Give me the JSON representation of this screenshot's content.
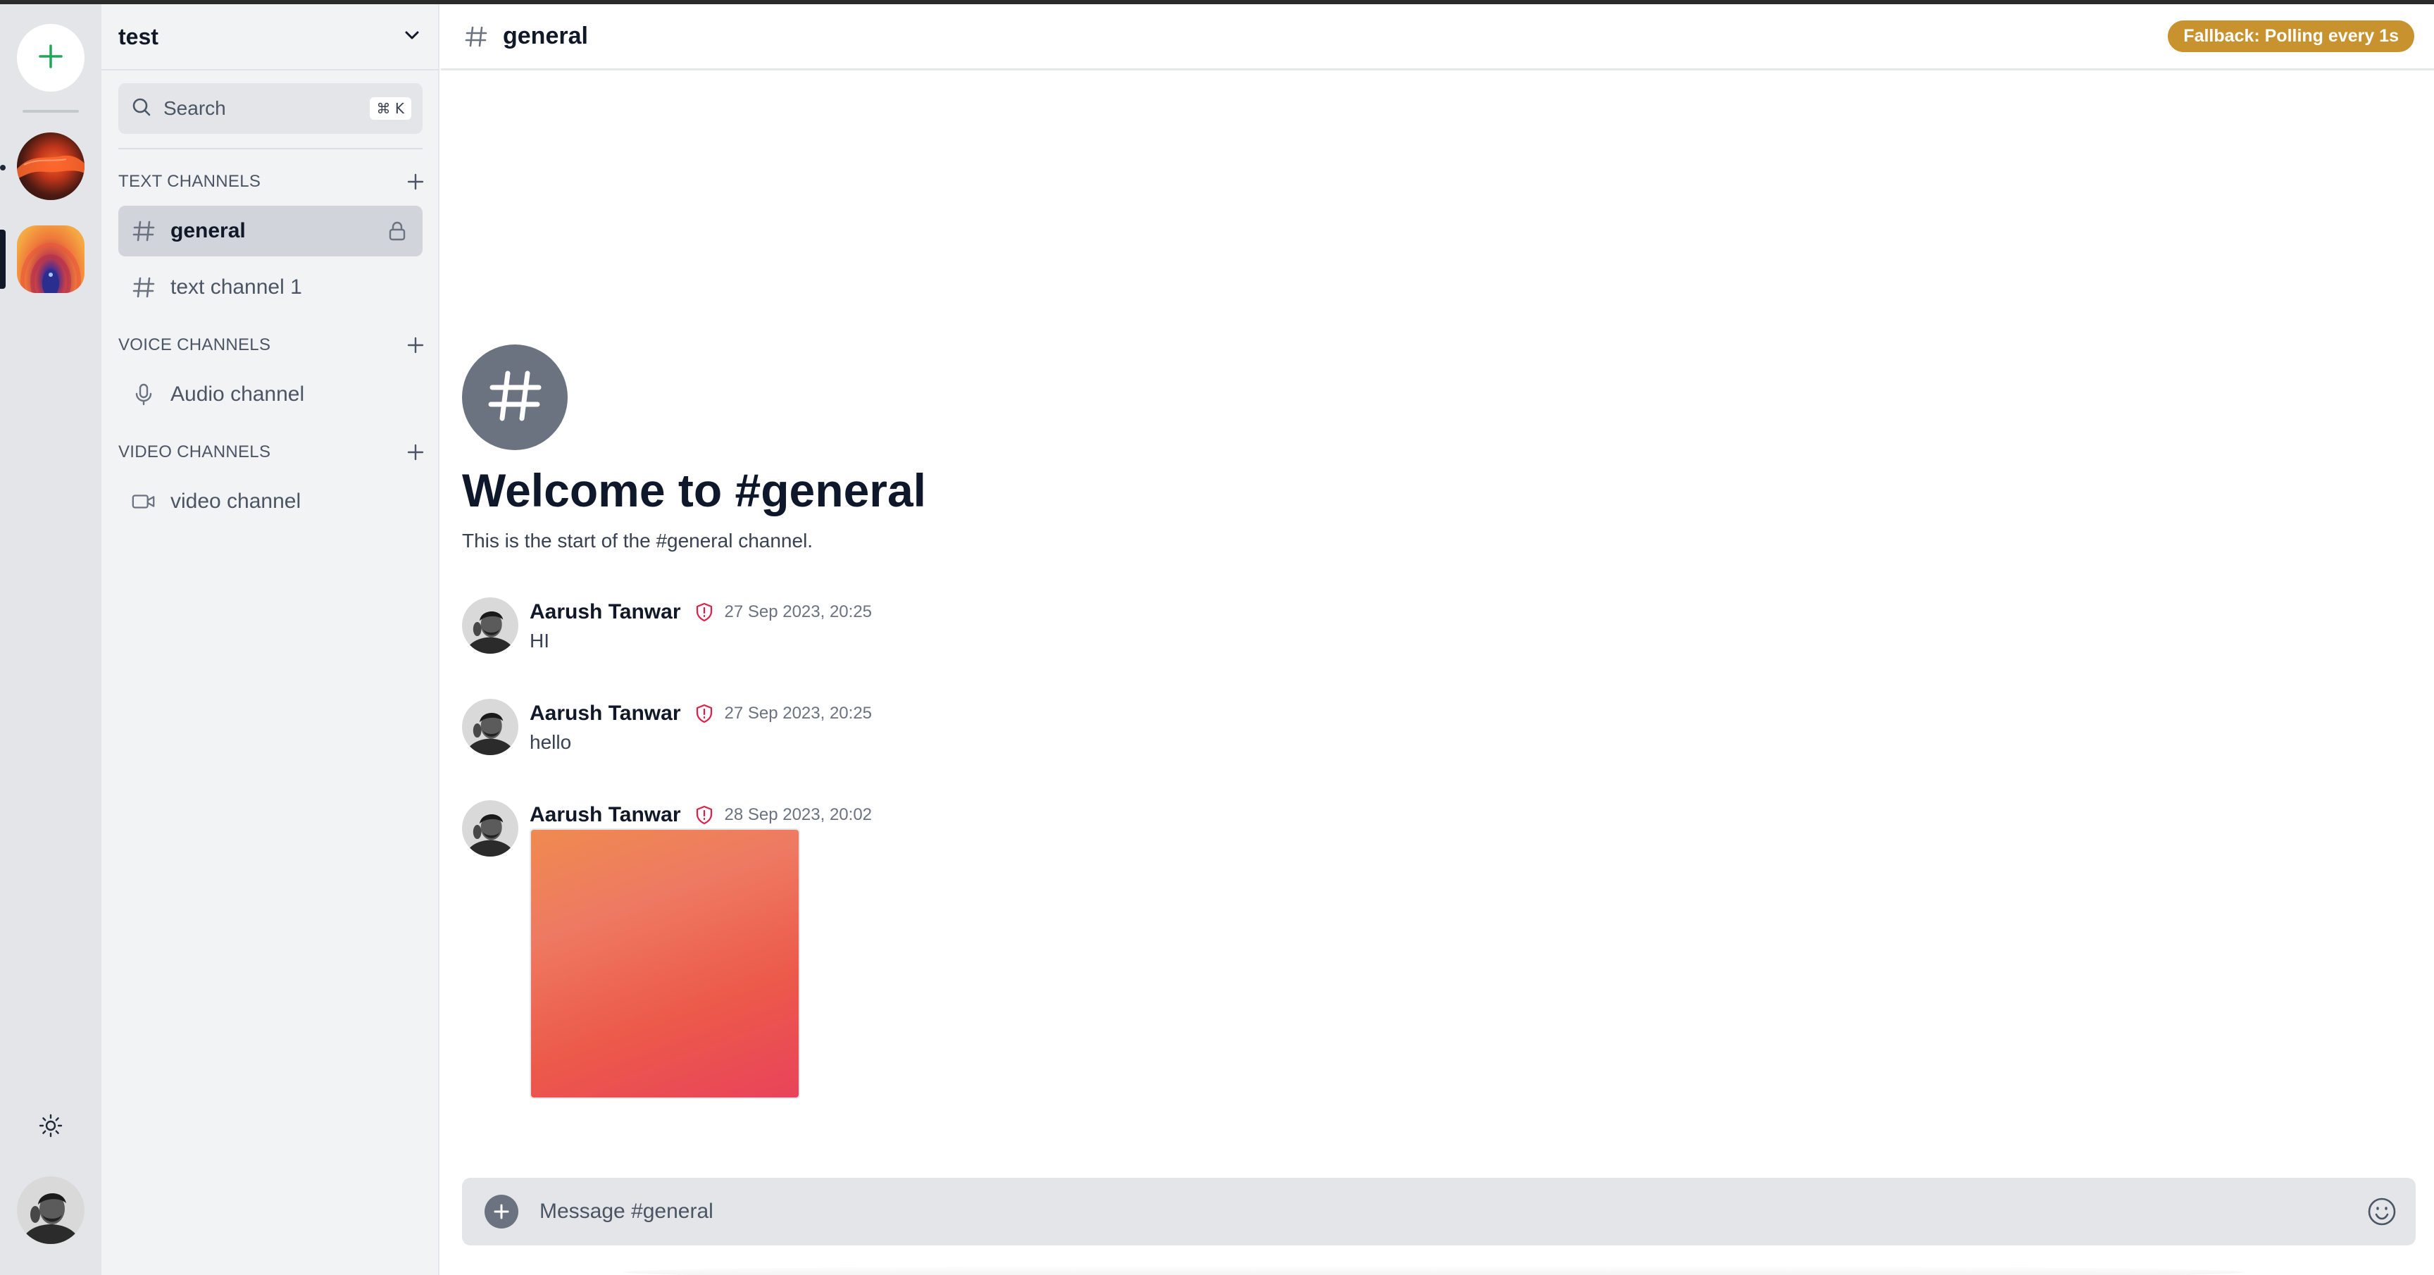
{
  "server": {
    "name": "test",
    "search_label": "Search",
    "search_shortcut": "⌘ K"
  },
  "sections": {
    "text": "TEXT CHANNELS",
    "voice": "VOICE CHANNELS",
    "video": "VIDEO CHANNELS"
  },
  "channels": {
    "text": [
      {
        "label": "general",
        "active": true,
        "locked": true
      },
      {
        "label": "text channel 1"
      }
    ],
    "voice": [
      {
        "label": "Audio channel"
      }
    ],
    "video": [
      {
        "label": "video channel"
      }
    ]
  },
  "header": {
    "title": "general",
    "status": "Fallback: Polling every 1s"
  },
  "welcome": {
    "title": "Welcome to #general",
    "subtitle": "This is the start of the #general channel."
  },
  "messages": [
    {
      "author": "Aarush Tanwar",
      "time": "27 Sep 2023, 20:25",
      "text": "HI"
    },
    {
      "author": "Aarush Tanwar",
      "time": "27 Sep 2023, 20:25",
      "text": "hello"
    },
    {
      "author": "Aarush Tanwar",
      "time": "28 Sep 2023, 20:02",
      "attachment": "image"
    }
  ],
  "composer": {
    "placeholder": "Message #general",
    "value": ""
  },
  "colors": {
    "status_badge": "#c8922f",
    "role_icon": "#e11d48",
    "add_server": "#22a559"
  }
}
